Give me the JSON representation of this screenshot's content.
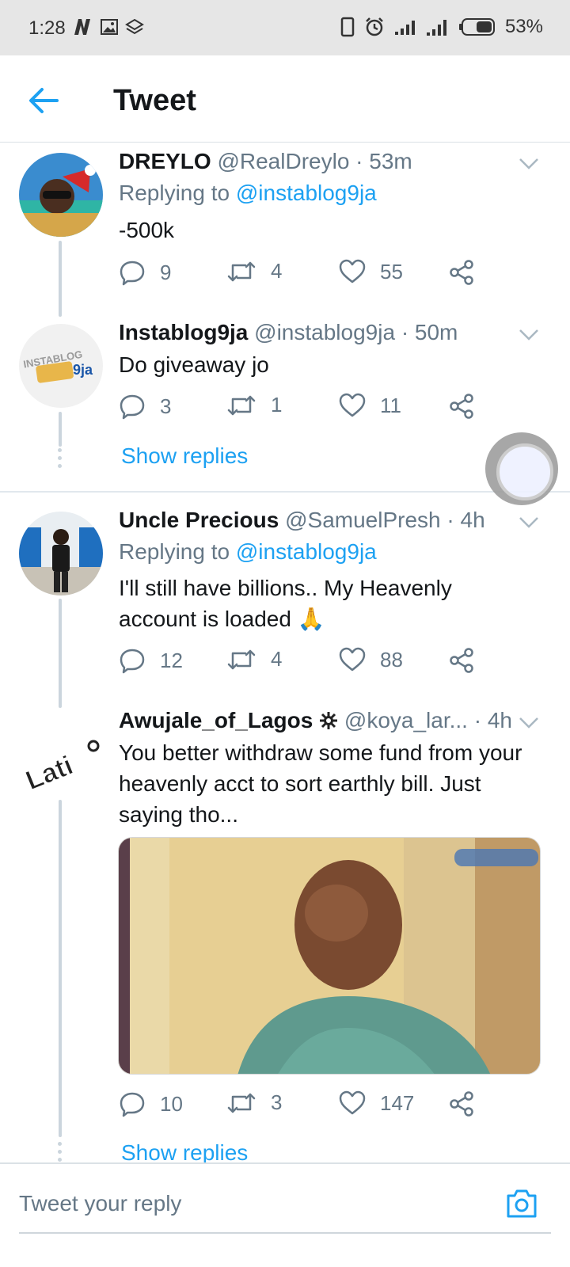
{
  "status_bar": {
    "time": "1:28",
    "battery": "53%"
  },
  "header": {
    "title": "Tweet"
  },
  "tweets": [
    {
      "name": "DREYLO",
      "handle": "@RealDreylo",
      "time": "· 53m",
      "replying_label": "Replying to",
      "replying_to": "@instablog9ja",
      "text": "-500k",
      "replies": "9",
      "retweets": "4",
      "likes": "55"
    },
    {
      "name": "Instablog9ja",
      "handle": "@instablog9ja",
      "time": "· 50m",
      "text": "Do giveaway jo",
      "replies": "3",
      "retweets": "1",
      "likes": "11",
      "show_replies": "Show replies"
    },
    {
      "name": "Uncle Precious",
      "handle": "@SamuelPresh",
      "time": "· 4h",
      "replying_label": "Replying to",
      "replying_to": "@instablog9ja",
      "text": "I'll still have billions.. My Heavenly account is loaded 🙏",
      "replies": "12",
      "retweets": "4",
      "likes": "88"
    },
    {
      "name": "Awujale_of_Lagos",
      "handle": "@koya_lar...",
      "time": "· 4h",
      "text": "You better withdraw some fund from your heavenly acct to sort earthly bill. Just saying tho...",
      "replies": "10",
      "retweets": "3",
      "likes": "147",
      "show_replies": "Show replies"
    }
  ],
  "avatar_texts": {
    "instablog_logo": "INSTABLOG 9ja",
    "latiyo_logo": "Lati"
  },
  "reply_bar": {
    "placeholder": "Tweet your reply"
  },
  "colors": {
    "accent": "#1da1f2",
    "secondary_text": "#657786",
    "primary_text": "#14171a",
    "status_bar_bg": "#e6e6e6"
  }
}
